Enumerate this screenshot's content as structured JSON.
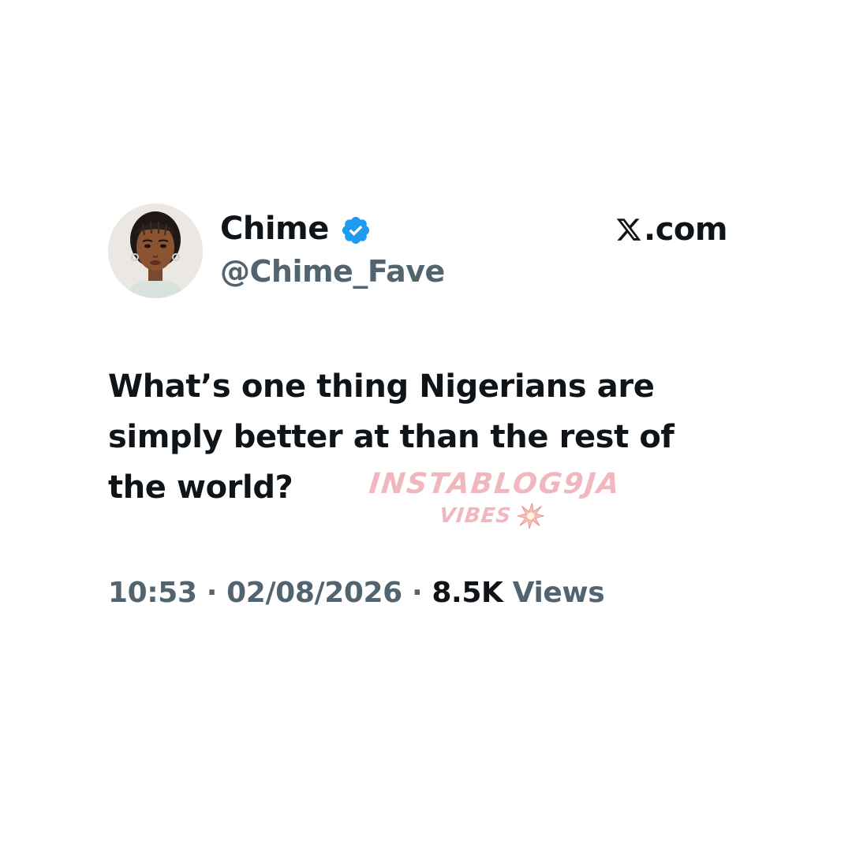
{
  "author": {
    "display_name": "Chime",
    "handle": "@Chime_Fave",
    "verified_color": "#1d9bf0",
    "avatar_icon": "profile-photo"
  },
  "site": {
    "label": ".com",
    "logo_icon": "x-logo-icon"
  },
  "tweet": {
    "text": "What’s one thing Nigerians are simply better at than the rest of the world?"
  },
  "meta": {
    "time": "10:53",
    "separator": " · ",
    "date": "02/08/2026",
    "views_count": "8.5K",
    "views_label": "Views"
  },
  "watermark": {
    "line1": "INSTABLOG9JA",
    "line2": "VIBES",
    "color": "#f0b7bf",
    "icon": "burst-icon"
  },
  "colors": {
    "text_primary": "#0f1419",
    "text_secondary": "#536471",
    "background": "#ffffff"
  }
}
